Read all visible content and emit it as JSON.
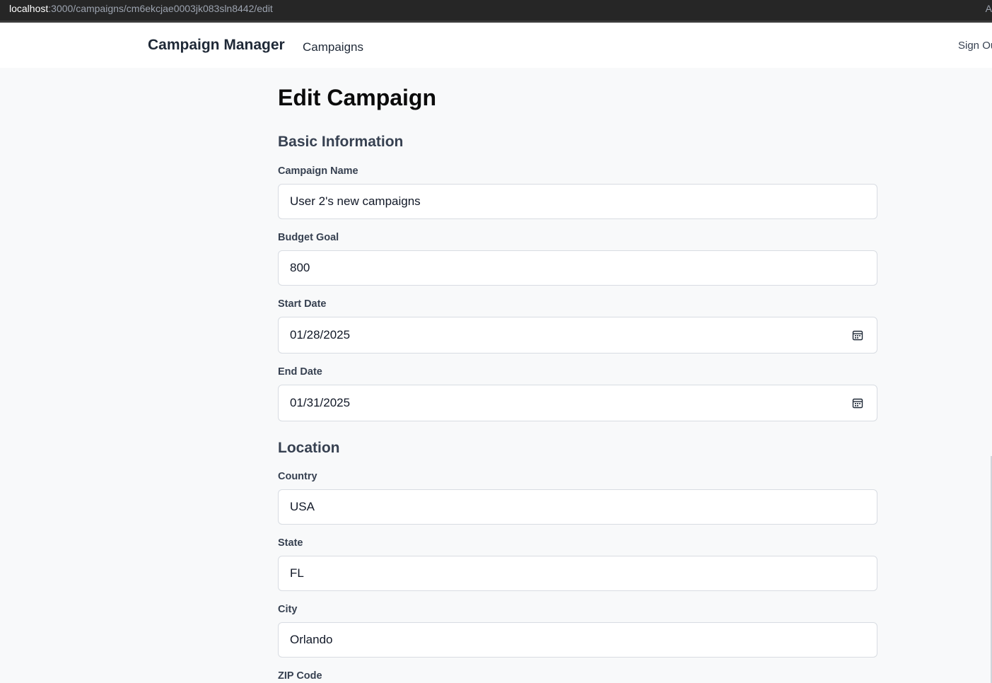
{
  "browser": {
    "url_host": "localhost",
    "url_rest": ":3000/campaigns/cm6ekcjae0003jk083sln8442/edit",
    "edge_glyph": "A"
  },
  "nav": {
    "brand": "Campaign Manager",
    "campaigns_link": "Campaigns",
    "sign_out": "Sign Ou"
  },
  "page": {
    "title": "Edit Campaign"
  },
  "basic_info": {
    "heading": "Basic Information",
    "campaign_name": {
      "label": "Campaign Name",
      "value": "User 2's new campaigns"
    },
    "budget_goal": {
      "label": "Budget Goal",
      "value": "800"
    },
    "start_date": {
      "label": "Start Date",
      "value": "01/28/2025",
      "icon": "calendar-icon"
    },
    "end_date": {
      "label": "End Date",
      "value": "01/31/2025",
      "icon": "calendar-icon"
    }
  },
  "location": {
    "heading": "Location",
    "country": {
      "label": "Country",
      "value": "USA"
    },
    "state": {
      "label": "State",
      "value": "FL"
    },
    "city": {
      "label": "City",
      "value": "Orlando"
    },
    "zip": {
      "label": "ZIP Code"
    }
  },
  "colors": {
    "page_bg": "#f8f9fa",
    "url_bar_bg": "#262626",
    "text_primary": "#111827",
    "label": "#374151",
    "field_border": "#d8dce2"
  }
}
